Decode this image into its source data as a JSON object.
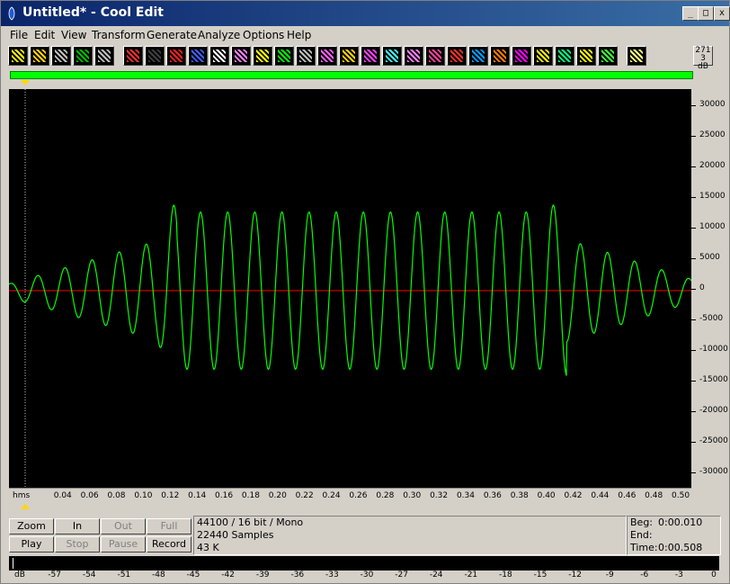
{
  "window": {
    "title": "Untitled* - Cool Edit"
  },
  "caption_buttons": {
    "minimize": "_",
    "maximize": "□",
    "close": "x"
  },
  "menu": [
    "File",
    "Edit",
    "View",
    "Transform",
    "Generate",
    "Analyze",
    "Options",
    "Help"
  ],
  "toolbar": {
    "icons": [
      "new-file-icon",
      "open-file-icon",
      "select-icon",
      "save-icon",
      "headphones-icon",
      "rewind-icon",
      "noise-icon",
      "loop-icon",
      "note-icon",
      "record-dot-icon",
      "envelope-icon",
      "triangle-icon",
      "spectrum-icon",
      "clock-icon",
      "echo-icon",
      "gain-icon",
      "flanger-icon",
      "reverb-icon",
      "filter-icon",
      "eq-icon",
      "noise-reduction-icon",
      "stretch-icon",
      "pitch-icon",
      "distortion-icon",
      "envelope-2-icon",
      "generate-noise-icon",
      "generate-tone-icon",
      "analyze-icon",
      "zoom-icon"
    ],
    "amp_button_lines": [
      "271",
      "3 dB"
    ]
  },
  "waveform": {
    "bg": "#000000",
    "wave_color": "#00ff00",
    "center_line_color": "#ff0000",
    "y_labels": [
      "30000",
      "25000",
      "20000",
      "15000",
      "10000",
      "5000",
      "0",
      "-5000",
      "-10000",
      "-15000",
      "-20000",
      "-25000",
      "-30000"
    ],
    "y_range": [
      -32768,
      32767
    ]
  },
  "time_ruler": {
    "unit": "hms",
    "labels": [
      "0.04",
      "0.06",
      "0.08",
      "0.10",
      "0.12",
      "0.14",
      "0.16",
      "0.18",
      "0.20",
      "0.22",
      "0.24",
      "0.26",
      "0.28",
      "0.30",
      "0.32",
      "0.34",
      "0.36",
      "0.38",
      "0.40",
      "0.42",
      "0.44",
      "0.46",
      "0.48",
      "0.50"
    ]
  },
  "controls": {
    "zoom": "Zoom",
    "zoom_in": "In",
    "zoom_out": "Out",
    "zoom_full": "Full",
    "play": "Play",
    "stop": "Stop",
    "pause": "Pause",
    "record": "Record"
  },
  "info": {
    "format": "44100 / 16 bit / Mono",
    "samples": "22440 Samples",
    "size": "43 K"
  },
  "selection": {
    "beg_label": "Beg:",
    "beg": "0:00.010",
    "end_label": "End:",
    "end": "",
    "time_label": "Time:",
    "time": "0:00.508"
  },
  "level_meter": {
    "labels": [
      "dB",
      "-57",
      "-54",
      "-51",
      "-48",
      "-45",
      "-42",
      "-39",
      "-36",
      "-33",
      "-30",
      "-27",
      "-24",
      "-21",
      "-18",
      "-15",
      "-12",
      "-9",
      "-6",
      "-3",
      "0"
    ]
  }
}
